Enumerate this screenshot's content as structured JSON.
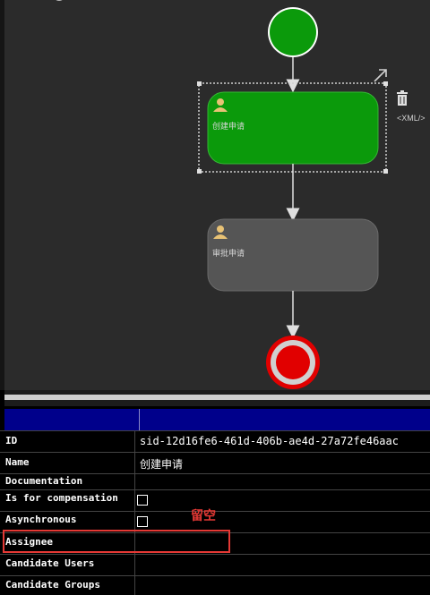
{
  "diagram": {
    "tasks": [
      {
        "label": "创建申请",
        "color": "#0b9a0b",
        "selected": true
      },
      {
        "label": "审批申请",
        "color": "#555555",
        "selected": false
      }
    ],
    "start_event_color": "#0b9a0b",
    "end_event_color": "#e10000",
    "xml_label": "<XML/>"
  },
  "properties": {
    "header": {
      "col1": "",
      "col2": ""
    },
    "rows": [
      {
        "key": "ID",
        "value": "sid-12d16fe6-461d-406b-ae4d-27a72fe46aac",
        "type": "text"
      },
      {
        "key": "Name",
        "value": "创建申请",
        "type": "text"
      },
      {
        "key": "Documentation",
        "value": "",
        "type": "text"
      },
      {
        "key": "Is for compensation",
        "value": "",
        "type": "checkbox"
      },
      {
        "key": "Asynchronous",
        "value": "",
        "type": "checkbox"
      },
      {
        "key": "Assignee",
        "value": "",
        "type": "text"
      },
      {
        "key": "Candidate Users",
        "value": "",
        "type": "text"
      },
      {
        "key": "Candidate Groups",
        "value": "",
        "type": "text"
      }
    ]
  },
  "annotation": {
    "text": "留空",
    "color": "#e53935"
  }
}
